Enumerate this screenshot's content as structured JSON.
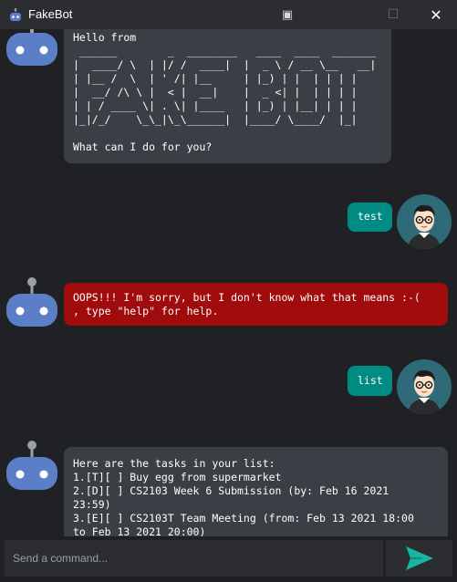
{
  "window": {
    "title": "FakeBot",
    "buttons": [
      "▣",
      "☐",
      "✕"
    ]
  },
  "messages": {
    "bot_greeting": "Hello from\n ______        _  ________   ____  ____  _______\n|  ____/ \\  | |/ /  ____|  |  _ \\ / __ \\__   __|\n| |__ /  \\  | ' /| |__     | |_) | |  | | | |\n|  __/ /\\ \\ |  < |  __|    |  _ <| |  | | | |\n| | / ____ \\| . \\| |____   | |_) | |__| | | |\n|_|/_/    \\_\\_|\\_\\______|  |____/ \\____/  |_|\n\nWhat can I do for you?",
    "user1": "test",
    "error": "OOPS!!! I'm sorry, but I don't know what that means :-(\n, type \"help\" for help.",
    "user2": "list",
    "task_list": "Here are the tasks in your list:\n1.[T][ ] Buy egg from supermarket\n2.[D][ ] CS2103 Week 6 Submission (by: Feb 16 2021\n23:59)\n3.[E][ ] CS2103T Team Meeting (from: Feb 13 2021 18:00\nto Feb 13 2021 20:00)"
  },
  "input": {
    "placeholder": "Send a command..."
  },
  "colors": {
    "bot_bubble": "#3a3f45",
    "error_bubble": "#a00b0b",
    "user_bubble": "#008b83",
    "send_arrow": "#17b3a3"
  }
}
